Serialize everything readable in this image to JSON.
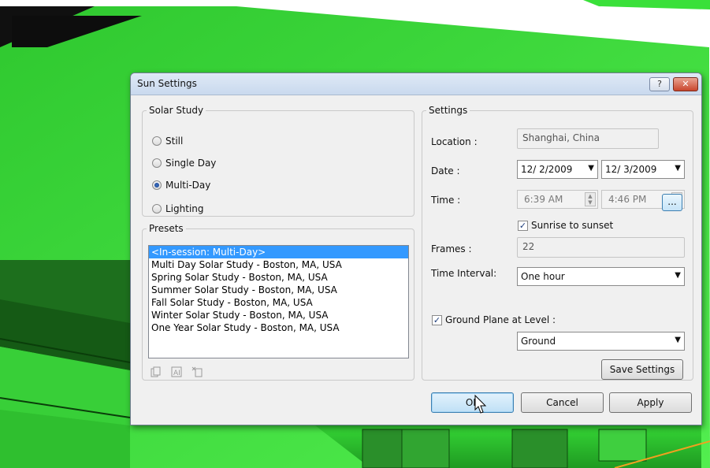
{
  "dialog": {
    "title": "Sun Settings",
    "help_glyph": "?",
    "close_glyph": "✕"
  },
  "solar_study": {
    "legend": "Solar Study",
    "options": [
      {
        "label": "Still",
        "checked": false
      },
      {
        "label": "Single Day",
        "checked": false
      },
      {
        "label": "Multi-Day",
        "checked": true
      },
      {
        "label": "Lighting",
        "checked": false
      }
    ]
  },
  "presets": {
    "legend": "Presets",
    "items": [
      {
        "label": "<In-session: Multi-Day>",
        "selected": true
      },
      {
        "label": "Multi Day Solar Study - Boston, MA, USA",
        "selected": false
      },
      {
        "label": "Spring Solar Study - Boston, MA, USA",
        "selected": false
      },
      {
        "label": "Summer Solar Study - Boston, MA, USA",
        "selected": false
      },
      {
        "label": "Fall Solar Study - Boston, MA, USA",
        "selected": false
      },
      {
        "label": "Winter Solar Study - Boston, MA, USA",
        "selected": false
      },
      {
        "label": "One Year Solar Study - Boston, MA, USA",
        "selected": false
      }
    ],
    "icons": [
      "duplicate-icon",
      "rename-icon",
      "delete-icon"
    ]
  },
  "settings": {
    "legend": "Settings",
    "location_label": "Location :",
    "location_value": "Shanghai, China",
    "browse_label": "...",
    "date_label": "Date :",
    "date_start": "12/ 2/2009",
    "date_end": "12/ 3/2009",
    "time_label": "Time :",
    "time_start": "6:39 AM",
    "time_end": "4:46 PM",
    "sunrise_label": "Sunrise to sunset",
    "sunrise_checked": true,
    "frames_label": "Frames :",
    "frames_value": "22",
    "interval_label": "Time Interval:",
    "interval_value": "One hour",
    "ground_plane_label": "Ground Plane at Level :",
    "ground_plane_checked": true,
    "level_value": "Ground",
    "save_label": "Save Settings"
  },
  "buttons": {
    "ok": "OK",
    "cancel": "Cancel",
    "apply": "Apply"
  },
  "colors": {
    "scene_green": "#3ddc3d",
    "selection_blue": "#3399ff",
    "default_button_border": "#3c7fb1"
  }
}
